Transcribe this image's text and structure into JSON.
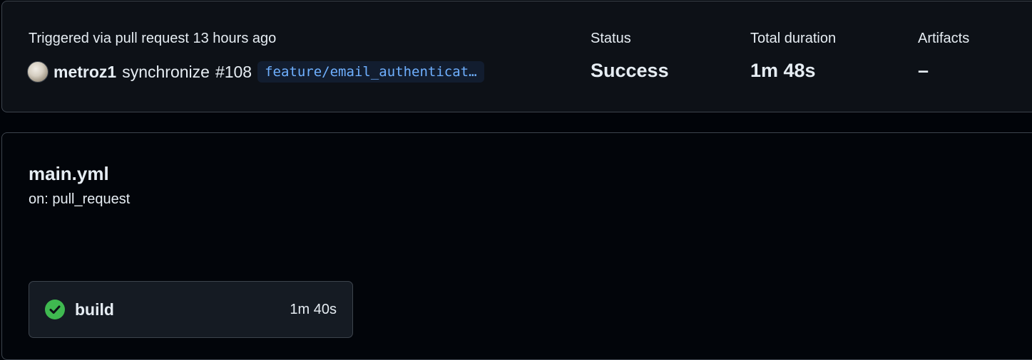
{
  "summary": {
    "trigger_text": "Triggered via pull request 13 hours ago",
    "actor": "metroz1",
    "event": "synchronize",
    "pr_number": "#108",
    "branch": "feature/email_authenticat…",
    "status": {
      "label": "Status",
      "value": "Success"
    },
    "duration": {
      "label": "Total duration",
      "value": "1m 48s"
    },
    "artifacts": {
      "label": "Artifacts",
      "value": "–"
    }
  },
  "workflow": {
    "name": "main.yml",
    "trigger": "on: pull_request",
    "jobs": [
      {
        "name": "build",
        "duration": "1m 40s",
        "status_icon": "check-circle-icon",
        "status_color": "#3fb950"
      }
    ]
  },
  "colors": {
    "background": "#010409",
    "card": "#0d1117",
    "border": "#3d444d",
    "branch_bg": "#121d2f",
    "branch_text": "#6fb0ff",
    "success": "#3fb950"
  }
}
